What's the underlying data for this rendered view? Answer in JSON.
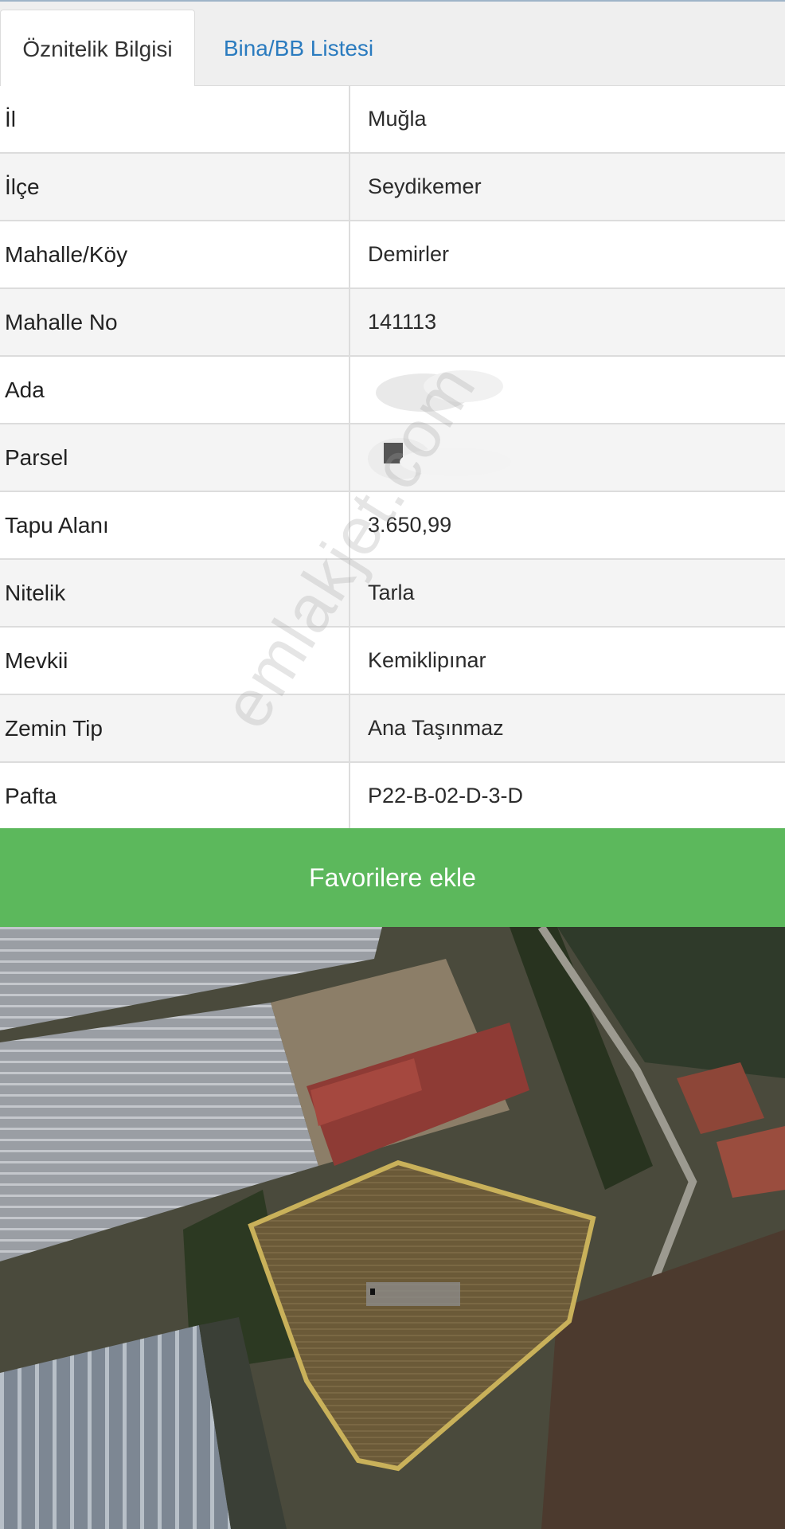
{
  "tabs": [
    {
      "label": "Öznitelik Bilgisi",
      "active": true
    },
    {
      "label": "Bina/BB Listesi",
      "active": false
    }
  ],
  "attributes": [
    {
      "label": "İl",
      "value": "Muğla"
    },
    {
      "label": "İlçe",
      "value": "Seydikemer"
    },
    {
      "label": "Mahalle/Köy",
      "value": "Demirler"
    },
    {
      "label": "Mahalle No",
      "value": "141113"
    },
    {
      "label": "Ada",
      "value": ""
    },
    {
      "label": "Parsel",
      "value": ""
    },
    {
      "label": "Tapu Alanı",
      "value": "3.650,99"
    },
    {
      "label": "Nitelik",
      "value": "Tarla"
    },
    {
      "label": "Mevkii",
      "value": "Kemiklipınar"
    },
    {
      "label": "Zemin Tip",
      "value": "Ana Taşınmaz"
    },
    {
      "label": "Pafta",
      "value": "P22-B-02-D-3-D"
    }
  ],
  "favorite_button": {
    "label": "Favorilere ekle",
    "color": "#5cb85c"
  },
  "watermark": "emlakjet.com",
  "colors": {
    "tab_link": "#2a7bbf",
    "parcel_outline": "#c9b15a"
  }
}
